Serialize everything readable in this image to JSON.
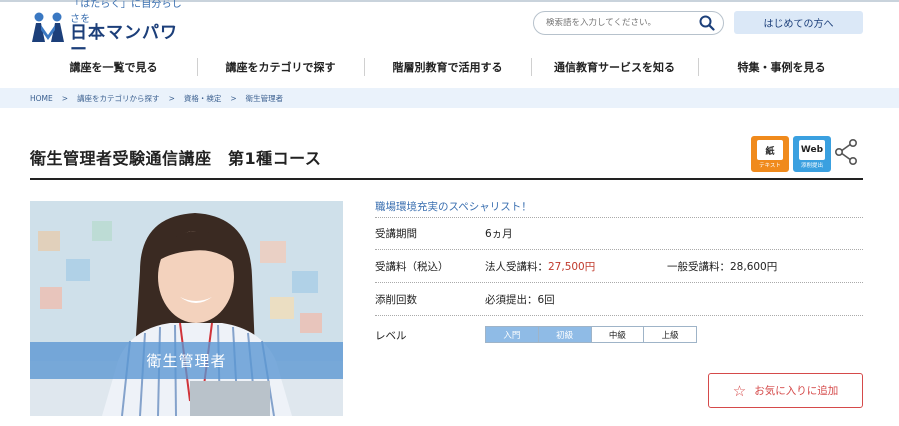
{
  "header": {
    "logo_tagline": "「はたらく」に自分らしさを",
    "logo_name": "日本マンパワー",
    "search_placeholder": "検索語を入力してください。",
    "first_time_label": "はじめての方へ"
  },
  "nav": {
    "items": [
      {
        "label": "講座を一覧で見る"
      },
      {
        "label": "講座をカテゴリで探す"
      },
      {
        "label": "階層別教育で活用する"
      },
      {
        "label": "通信教育サービスを知る"
      },
      {
        "label": "特集・事例を見る"
      }
    ]
  },
  "breadcrumb": [
    "HOME",
    "講座をカテゴリから探す",
    "資格・検定",
    "衛生管理者"
  ],
  "breadcrumb_sep": ">",
  "course": {
    "title": "衛生管理者受験通信講座　第1種コース",
    "badge_paper": {
      "icon_text": "紙",
      "caption": "テキスト"
    },
    "badge_web": {
      "icon_text": "Web",
      "caption": "添削提出"
    },
    "photo_label": "衛生管理者",
    "lead": "職場環境充実のスペシャリスト！",
    "period_label": "受講期間",
    "period_value": "6ヵ月",
    "fee_label": "受講料（税込）",
    "fee_corp_label": "法人受講料：",
    "fee_corp_value": "27,500円",
    "fee_general": "一般受講料：28,600円",
    "correction_label": "添削回数",
    "correction_value": "必須提出：6回",
    "level_label": "レベル",
    "levels": [
      {
        "label": "入門",
        "active": true
      },
      {
        "label": "初級",
        "active": true
      },
      {
        "label": "中級",
        "active": false
      },
      {
        "label": "上級",
        "active": false
      }
    ],
    "favorite_label": "お気に入りに追加"
  },
  "colors": {
    "accent_blue": "#3a6fb0",
    "price_red": "#c0392b",
    "favorite_red": "#d54a4a",
    "badge_orange": "#f08a1c",
    "badge_blue": "#3aa0e0"
  }
}
